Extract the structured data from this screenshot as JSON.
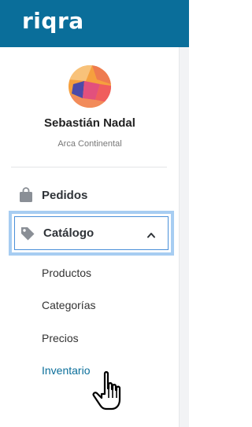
{
  "header": {
    "logo_text": "riqra",
    "brand_color": "#0a6e9a"
  },
  "user": {
    "name": "Sebastián Nadal",
    "organization": "Arca Continental"
  },
  "nav": {
    "items": [
      {
        "label": "Pedidos",
        "icon": "shopping-bag-icon"
      },
      {
        "label": "Catálogo",
        "icon": "tag-icon",
        "expanded": true,
        "focused": true
      }
    ],
    "catalog_subitems": [
      {
        "label": "Productos"
      },
      {
        "label": "Categorías"
      },
      {
        "label": "Precios"
      },
      {
        "label": "Inventario",
        "hovered": true
      }
    ]
  },
  "colors": {
    "focus_ring": "#a7cdf2",
    "hover_text": "#0a6e9a"
  }
}
